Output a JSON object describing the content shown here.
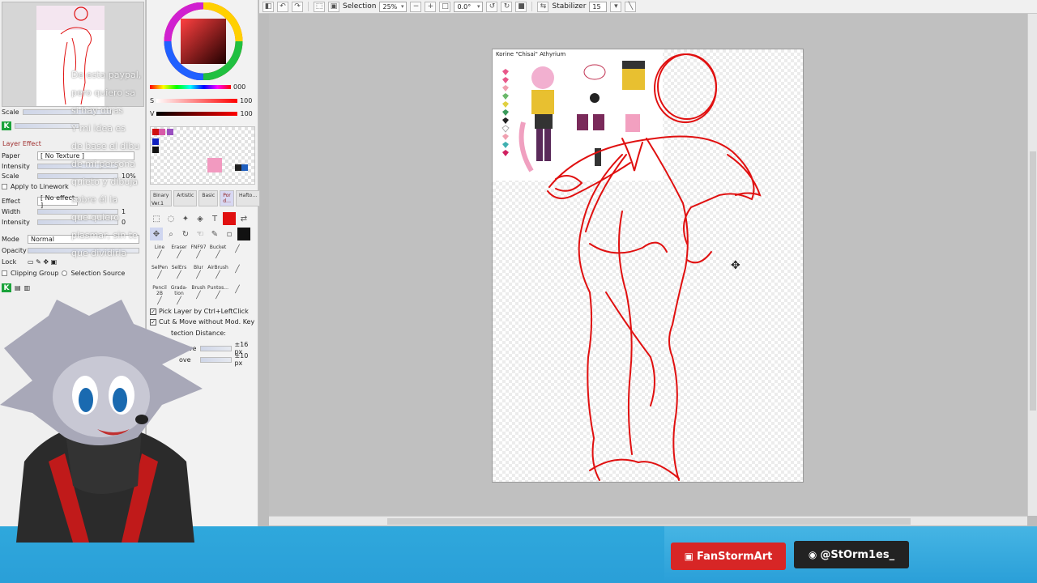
{
  "toolbar": {
    "selection_label": "Selection",
    "zoom": "25%",
    "rotation": "0.0°",
    "stabilizer_label": "Stabilizer",
    "stabilizer_value": "15"
  },
  "navigator": {
    "scale_label": "Scale"
  },
  "layer_effect": {
    "title": "Layer Effect",
    "paper_label": "Paper",
    "paper_value": "[ No Texture ]",
    "intensity_label": "Intensity",
    "scale_label": "Scale",
    "scale_value": "10%",
    "apply_lineart": "Apply to Linework",
    "effect_label": "Effect",
    "effect_value": "[ No effect ]",
    "width_label": "Width",
    "width_value": "1",
    "intensity2_label": "Intensity",
    "intensity2_value": "0"
  },
  "layer_props": {
    "mode_label": "Mode",
    "mode_value": "Normal",
    "opacity_label": "Opacity",
    "lock_label": "Lock",
    "clipping_group": "Clipping Group",
    "selection_source": "Selection Source"
  },
  "color": {
    "s_label": "S",
    "v_label": "V",
    "h_value": "000",
    "s_value": "100",
    "v_value": "100"
  },
  "tool_tabs": [
    "Binary",
    "Artistic",
    "Basic",
    "Por d…",
    "Hafto…"
  ],
  "tool_tab_version": "Ver.1",
  "brushes": [
    {
      "label": "Line"
    },
    {
      "label": "Eraser"
    },
    {
      "label": "FNF97"
    },
    {
      "label": "Bucket"
    },
    {
      "label": ""
    },
    {
      "label": "SelPen"
    },
    {
      "label": "SelErs"
    },
    {
      "label": "Blur"
    },
    {
      "label": "AirBrush"
    },
    {
      "label": ""
    },
    {
      "label": "Pencil 2B"
    },
    {
      "label": "Grada-tion"
    },
    {
      "label": "Brush"
    },
    {
      "label": "Puntos..."
    },
    {
      "label": ""
    }
  ],
  "move_options": {
    "pick_layer": "Pick Layer by Ctrl+LeftClick",
    "cut_move": "Cut & Move without Mod. Key",
    "detection": "tection Distance:",
    "move_label": "Move",
    "move_value": "±16 px",
    "move2_label": "ove",
    "move2_value": "±10 px"
  },
  "canvas": {
    "ref_title": "Korine \"Chisai\" Athyrium"
  },
  "chat_overlay": [
    "De esta paypal,",
    "pero quiero sa",
    "si hay otras",
    "Y mi idea es",
    "de base el dibu",
    "de mi persona",
    "quieto y dibuja",
    "sobre él la",
    "que quiero",
    "plasmar, sin te",
    "que dividirla"
  ],
  "overlay": {
    "name_tag": "FanStormArt",
    "handle_tag": "@StOrm1es_"
  },
  "colors": {
    "accent_red": "#e01010",
    "band_blue": "#2fa8dc",
    "tag_red": "#d72626"
  }
}
